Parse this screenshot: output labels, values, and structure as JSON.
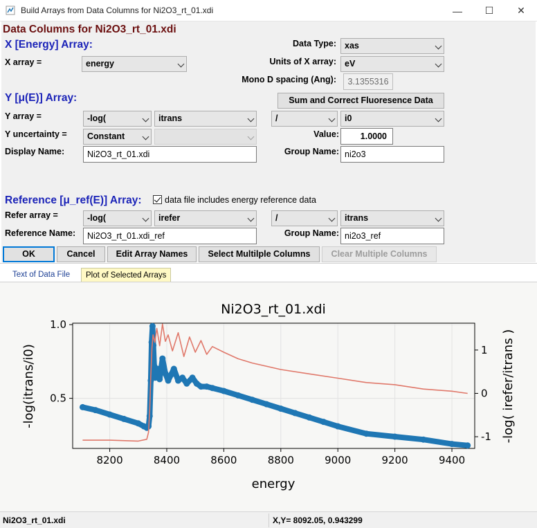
{
  "window": {
    "title": "Build Arrays from Data Columns for Ni2O3_rt_01.xdi",
    "minimize": "—",
    "maximize": "☐",
    "close": "✕"
  },
  "form": {
    "header": "Data Columns for Ni2O3_rt_01.xdi",
    "x_section": {
      "heading": "X [Energy] Array:",
      "x_array_label": "X array =",
      "x_array_value": "energy",
      "data_type_label": "Data Type:",
      "data_type_value": "xas",
      "units_label": "Units of X array:",
      "units_value": "eV",
      "mono_label": "Mono D spacing (Ang):",
      "mono_value": "3.1355316"
    },
    "y_section": {
      "heading": "Y [μ(E)] Array:",
      "sum_button": "Sum and Correct Fluoresence Data",
      "y_array_label": "Y array =",
      "y_op": "-log(",
      "y_numerator": "itrans",
      "y_divide": "/",
      "y_denominator": "i0",
      "y_unc_label": "Y uncertainty =",
      "y_unc_value": "Constant",
      "y_unc_column": "",
      "value_label": "Value:",
      "value_value": "1.0000",
      "display_name_label": "Display Name:",
      "display_name_value": "Ni2O3_rt_01.xdi",
      "group_name_label": "Group Name:",
      "group_name_value": "ni2o3"
    },
    "ref_section": {
      "heading": "Reference [μ_ref(E)] Array:",
      "checkbox_label": "data file includes energy reference data",
      "checkbox_checked": true,
      "refer_label": "Refer array =",
      "ref_op": "-log(",
      "ref_numerator": "irefer",
      "ref_divide": "/",
      "ref_denominator": "itrans",
      "ref_name_label": "Reference Name:",
      "ref_name_value": "Ni2O3_rt_01.xdi_ref",
      "ref_group_label": "Group Name:",
      "ref_group_value": "ni2o3_ref"
    },
    "buttons": {
      "ok": "OK",
      "cancel": "Cancel",
      "edit": "Edit Array Names",
      "select_multiple": "Select Multilple Columns",
      "clear_multiple": "Clear Multiple Columns"
    }
  },
  "tabs": [
    {
      "label": "Text of Data File",
      "active": false
    },
    {
      "label": "Plot of Selected Arrays",
      "active": true
    }
  ],
  "plot_labels": {
    "title": "Ni2O3_rt_01.xdi",
    "xlabel": "energy",
    "ylabel_left": "-log(itrans/i0)",
    "ylabel_right": "-log( irefer/itrans )"
  },
  "status": {
    "left": "Ni2O3_rt_01.xdi",
    "right": "X,Y= 8092.05, 0.943299"
  },
  "colors": {
    "series_main": "#1f77b4",
    "series_ref": "#e0786a",
    "header_red": "#6b0f0f",
    "header_blue": "#1b23b8",
    "tab_active_bg": "#fff9c4"
  },
  "chart_data": {
    "type": "line",
    "title": "Ni2O3_rt_01.xdi",
    "xlabel": "energy",
    "ylabel": "-log(itrans/i0)",
    "y2label": "-log( irefer/itrans )",
    "xlim": [
      8070,
      9480
    ],
    "ylim": [
      0.16,
      1.01
    ],
    "y2lim": [
      -1.27,
      1.62
    ],
    "xticks": [
      8200,
      8400,
      8600,
      8800,
      9000,
      9200,
      9400
    ],
    "yticks": [
      0.5,
      1.0
    ],
    "y2ticks": [
      -1,
      0,
      1
    ],
    "grid": true,
    "legend": "none",
    "series": [
      {
        "name": "-log(itrans/i0)",
        "axis": "left",
        "style": "thick-markers",
        "x": [
          8105,
          8150,
          8200,
          8250,
          8300,
          8320,
          8330,
          8336,
          8340,
          8344,
          8347,
          8350,
          8353,
          8356,
          8360,
          8368,
          8375,
          8385,
          8395,
          8405,
          8415,
          8425,
          8440,
          8455,
          8470,
          8490,
          8505,
          8520,
          8540,
          8560,
          8600,
          8650,
          8700,
          8750,
          8800,
          8850,
          8900,
          8950,
          9000,
          9100,
          9200,
          9300,
          9400,
          9455
        ],
        "y": [
          0.44,
          0.42,
          0.39,
          0.36,
          0.33,
          0.31,
          0.3,
          0.31,
          0.38,
          0.62,
          0.88,
          0.99,
          0.86,
          0.72,
          0.64,
          0.7,
          0.63,
          0.77,
          0.67,
          0.62,
          0.66,
          0.7,
          0.62,
          0.64,
          0.6,
          0.64,
          0.6,
          0.58,
          0.58,
          0.57,
          0.55,
          0.52,
          0.49,
          0.46,
          0.43,
          0.4,
          0.37,
          0.34,
          0.31,
          0.26,
          0.24,
          0.22,
          0.19,
          0.18
        ]
      },
      {
        "name": "-log( irefer/itrans )",
        "axis": "right",
        "style": "thin-line",
        "x": [
          8105,
          8200,
          8300,
          8330,
          8336,
          8340,
          8344,
          8348,
          8352,
          8358,
          8365,
          8375,
          8385,
          8395,
          8405,
          8420,
          8440,
          8460,
          8480,
          8500,
          8520,
          8540,
          8560,
          8600,
          8650,
          8700,
          8800,
          8900,
          9000,
          9100,
          9200,
          9300,
          9400,
          9455
        ],
        "y": [
          -1.08,
          -1.08,
          -1.1,
          -1.06,
          -0.9,
          -0.4,
          0.4,
          1.05,
          1.35,
          1.18,
          1.5,
          1.1,
          1.6,
          1.2,
          1.35,
          0.98,
          1.4,
          0.85,
          1.3,
          0.95,
          1.22,
          0.9,
          1.08,
          0.95,
          0.8,
          0.7,
          0.55,
          0.45,
          0.35,
          0.25,
          0.2,
          0.1,
          0.05,
          0.0
        ]
      }
    ]
  }
}
